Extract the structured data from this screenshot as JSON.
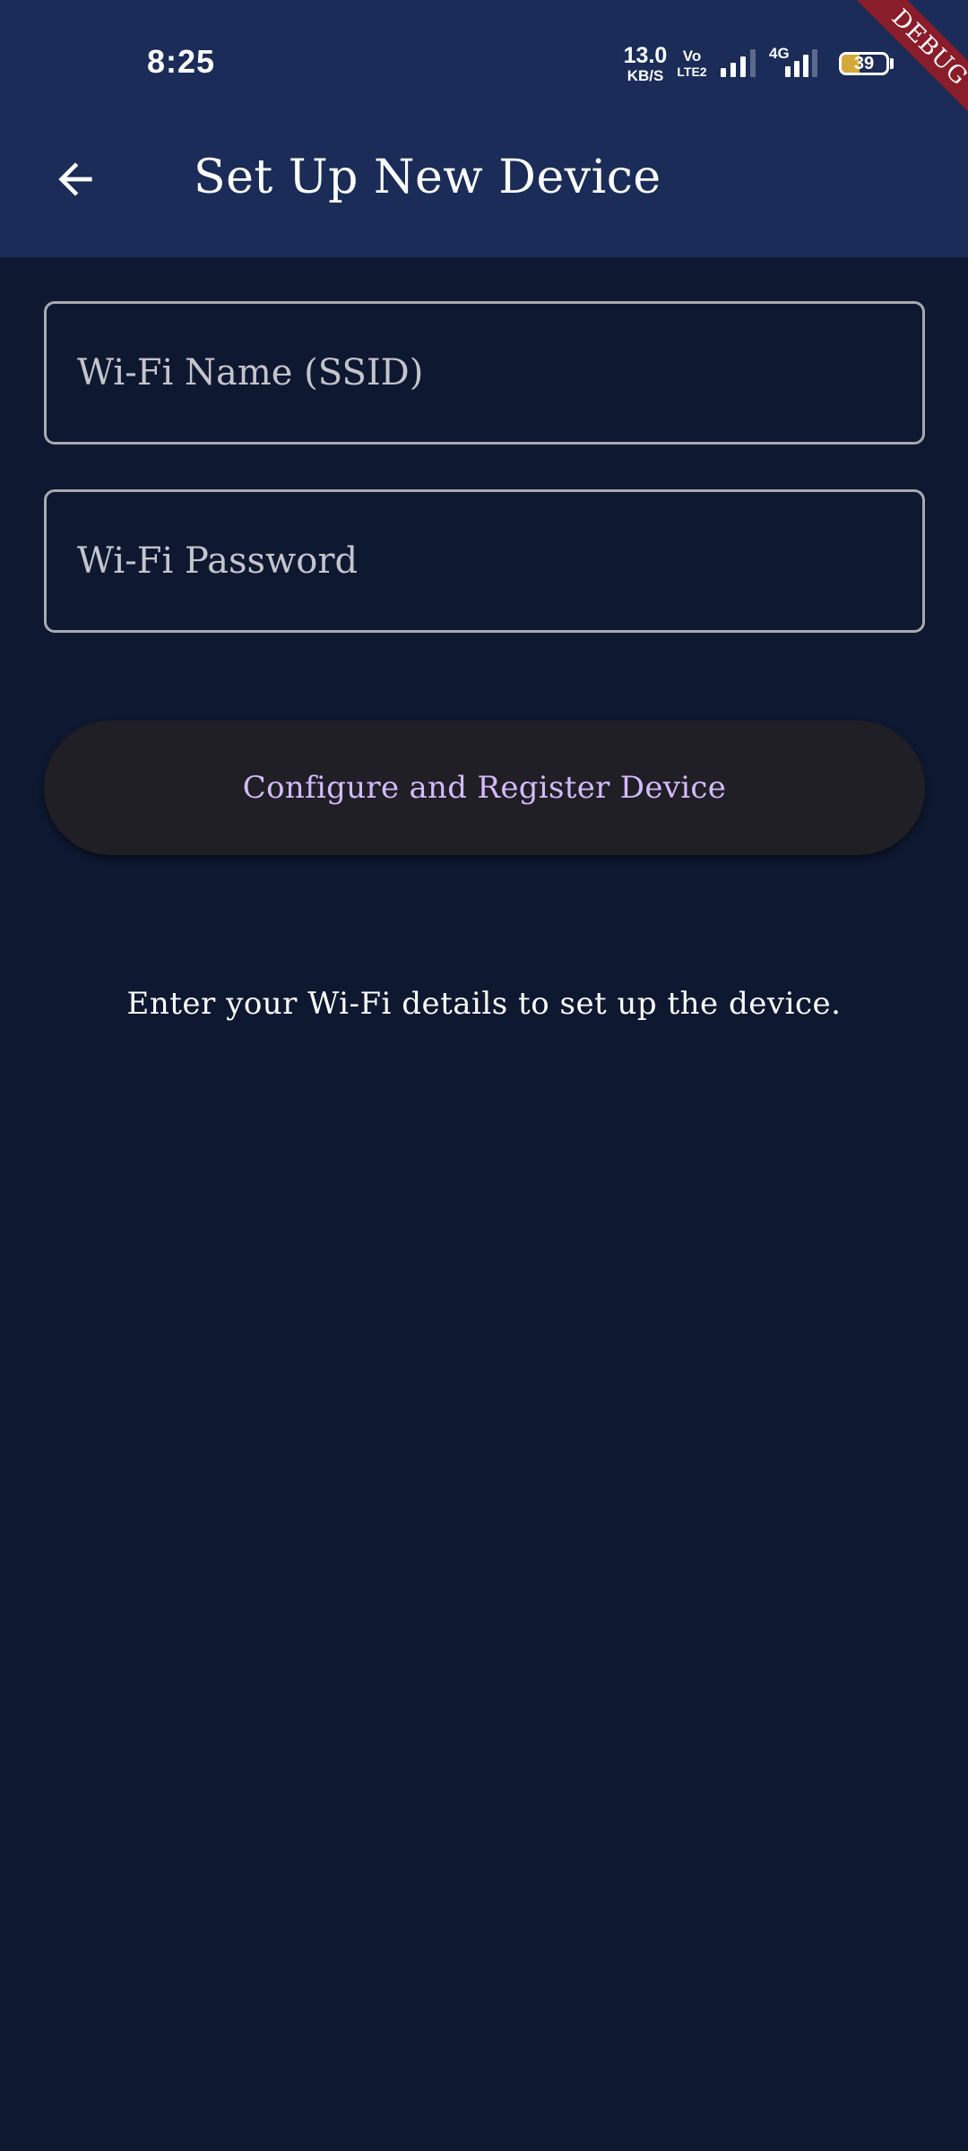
{
  "status_bar": {
    "time": "8:25",
    "net_speed_value": "13.0",
    "net_speed_unit": "KB/S",
    "volte_top": "Vo",
    "volte_bottom": "LTE2",
    "network_type": "4G",
    "battery_percent": "39",
    "battery_level": 0.39,
    "debug_banner": "DEBUG"
  },
  "app_bar": {
    "back_icon": "arrow-left-icon",
    "title": "Set Up New Device"
  },
  "form": {
    "ssid": {
      "placeholder": "Wi-Fi Name (SSID)",
      "value": ""
    },
    "password": {
      "placeholder": "Wi-Fi Password",
      "value": ""
    },
    "submit_label": "Configure and Register Device"
  },
  "hint_text": "Enter your Wi-Fi details to set up the device.",
  "colors": {
    "background": "#0e1830",
    "app_bar": "#1a2c57",
    "button_bg": "#211f26",
    "button_text": "#d3bcfc",
    "field_border": "#a8a9b0",
    "debug_ribbon": "#8a1d2a",
    "battery_fill": "#d4a93a"
  }
}
